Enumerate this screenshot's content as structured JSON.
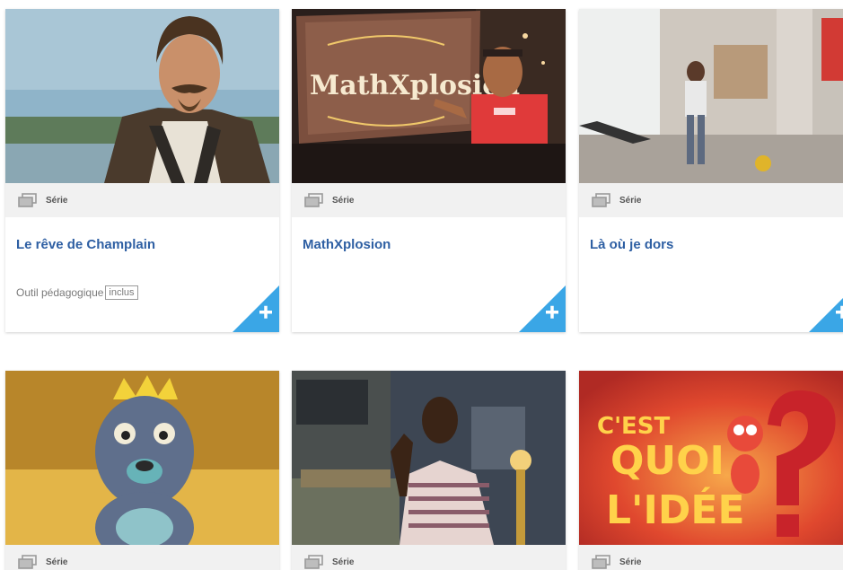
{
  "colors": {
    "title": "#2e5fa3",
    "accent": "#3aa6e6",
    "type_bar": "#f1f1f1"
  },
  "cards": [
    {
      "type": "Série",
      "title": "Le rêve de Champlain",
      "meta_label": "Outil pédagogique",
      "meta_badge": "inclus",
      "thumbnail": "man-with-long-hair-and-mustache-in-period-costume",
      "add_icon": "plus-icon"
    },
    {
      "type": "Série",
      "title": "MathXplosion",
      "thumbnail": "host-in-red-tshirt-pointing-at-mathxplosion-sign",
      "thumbnail_text": "MathXplosion",
      "add_icon": "plus-icon"
    },
    {
      "type": "Série",
      "title": "Là où je dors",
      "thumbnail": "children-playing-with-ball-in-room",
      "add_icon": "plus-icon"
    },
    {
      "type": "Série",
      "thumbnail": "blue-puppet-with-yellow-crown"
    },
    {
      "type": "Série",
      "thumbnail": "young-man-in-striped-shirt-in-dark-room"
    },
    {
      "type": "Série",
      "thumbnail": "cest-quoi-lidee-logo-with-red-character",
      "thumbnail_text": "C'EST QUOI L'IDÉE"
    }
  ]
}
